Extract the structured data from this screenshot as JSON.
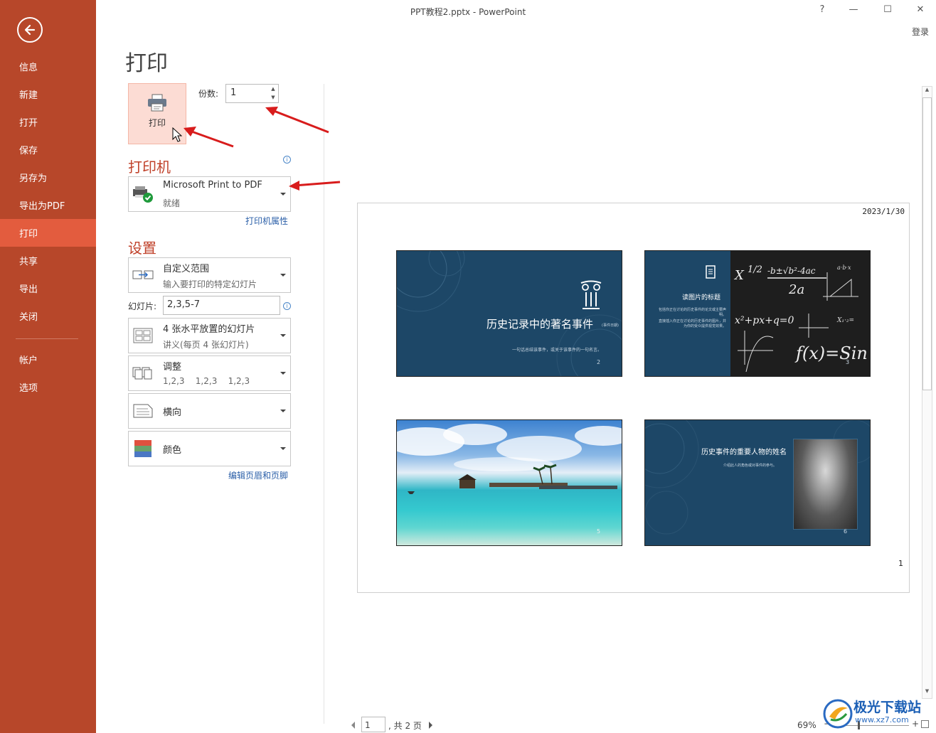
{
  "window": {
    "title": "PPT教程2.pptx - PowerPoint",
    "help": "?",
    "minimize": "—",
    "maximize": "☐",
    "close": "✕",
    "login": "登录"
  },
  "sidebar": {
    "items": [
      "信息",
      "新建",
      "打开",
      "保存",
      "另存为",
      "导出为PDF",
      "打印",
      "共享",
      "导出",
      "关闭"
    ],
    "items2": [
      "帐户",
      "选项"
    ],
    "active": "打印"
  },
  "print": {
    "title": "打印",
    "button_label": "打印",
    "copies_label": "份数:",
    "copies_value": "1",
    "info": "i"
  },
  "printer": {
    "section_title": "打印机",
    "name": "Microsoft Print to PDF",
    "status": "就绪",
    "properties_link": "打印机属性"
  },
  "settings": {
    "section_title": "设置",
    "range": {
      "title": "自定义范围",
      "desc": "输入要打印的特定幻灯片"
    },
    "slides_label": "幻灯片:",
    "slides_value": "2,3,5-7",
    "layout": {
      "title": "4 张水平放置的幻灯片",
      "desc": "讲义(每页 4 张幻灯片)"
    },
    "collate": {
      "title": "调整",
      "desc": "1,2,3    1,2,3    1,2,3"
    },
    "orientation": {
      "title": "横向"
    },
    "color": {
      "title": "颜色"
    },
    "header_footer_link": "编辑页眉和页脚"
  },
  "preview": {
    "date": "2023/1/30",
    "page_number": "1",
    "slides": [
      {
        "title": "历史记录中的著名事件",
        "tag": "(事件日期)",
        "subtitle": "一句话总结该事件，或关于该事件的一句名言。",
        "num": "2"
      },
      {
        "title": "读图片的标题",
        "body1": "包括你正在讨论的历史事件的论文或主要声明。",
        "body2": "直接插入你正在讨论的历史事件的图片，并为你的受众提供视觉效果。",
        "num": "3"
      },
      {
        "num": "5"
      },
      {
        "title": "历史事件的重要人物的姓名",
        "subtitle": "介绍此人的角色或对事件的参与。",
        "num": "6"
      }
    ]
  },
  "bottombar": {
    "current_page": "1",
    "total": ", 共 2 页",
    "zoom": "69%",
    "minus": "−",
    "plus": "+"
  },
  "watermark": {
    "name": "极光下载站",
    "url": "www.xz7.com"
  }
}
